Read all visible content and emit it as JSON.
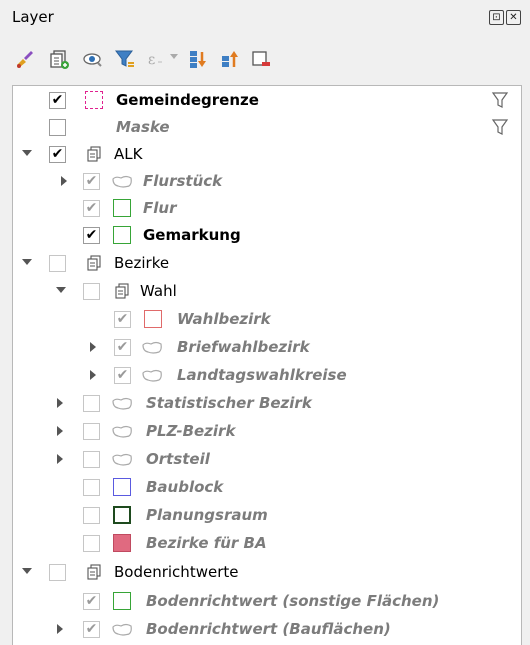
{
  "panel": {
    "title": "Layer",
    "float_btn": "⊡",
    "close_btn": "✕"
  },
  "toolbar": {
    "icons": [
      "style-manager-icon",
      "add-group-icon",
      "visibility-icon",
      "filter-legend-icon",
      "expression-filter-icon",
      "expand-all-icon",
      "collapse-all-icon",
      "remove-layer-icon"
    ]
  },
  "tree": {
    "gemeindegrenze": {
      "label": "Gemeindegrenze",
      "checked": "✔",
      "color": "#e0208f"
    },
    "maske": {
      "label": "Maske",
      "checked": ""
    },
    "alk": {
      "label": "ALK",
      "checked": "✔"
    },
    "flurstueck": {
      "label": "Flurstück",
      "checked": "✔"
    },
    "flur": {
      "label": "Flur",
      "checked": "✔",
      "color": "#37a537"
    },
    "gemarkung": {
      "label": "Gemarkung",
      "checked": "✔",
      "color": "#37a537"
    },
    "bezirke": {
      "label": "Bezirke",
      "checked": ""
    },
    "wahl": {
      "label": "Wahl",
      "checked": ""
    },
    "wahlbezirk": {
      "label": "Wahlbezirk",
      "checked": "✔",
      "color": "#e06a6a"
    },
    "briefwahlbezirk": {
      "label": "Briefwahlbezirk",
      "checked": "✔"
    },
    "landtagswahlkreise": {
      "label": "Landtagswahlkreise",
      "checked": "✔"
    },
    "statistischer_bezirk": {
      "label": "Statistischer Bezirk",
      "checked": ""
    },
    "plz_bezirk": {
      "label": "PLZ-Bezirk",
      "checked": ""
    },
    "ortsteil": {
      "label": "Ortsteil",
      "checked": ""
    },
    "baublock": {
      "label": "Baublock",
      "checked": "",
      "color": "#5a5ae0"
    },
    "planungsraum": {
      "label": "Planungsraum",
      "checked": "",
      "color": "#1e4a1e"
    },
    "bezirke_ba": {
      "label": "Bezirke für BA",
      "checked": "",
      "color": "#e06a80"
    },
    "bodenrichtwerte": {
      "label": "Bodenrichtwerte",
      "checked": ""
    },
    "brw_sonstige": {
      "label": "Bodenrichtwert (sonstige Flächen)",
      "checked": "✔",
      "color": "#37a537"
    },
    "brw_bau": {
      "label": "Bodenrichtwert (Bauflächen)",
      "checked": "✔"
    }
  }
}
